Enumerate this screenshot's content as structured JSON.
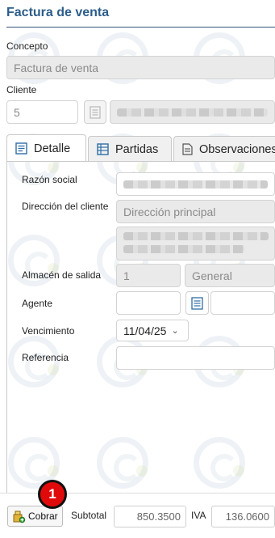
{
  "page": {
    "title": "Factura de venta"
  },
  "concepto": {
    "label": "Concepto",
    "value": "Factura de venta"
  },
  "cliente": {
    "label": "Cliente",
    "code": "5"
  },
  "tabs": [
    {
      "label": "Detalle",
      "icon": "document-lines-icon",
      "active": true
    },
    {
      "label": "Partidas",
      "icon": "table-grid-icon",
      "active": false
    },
    {
      "label": "Observaciones",
      "icon": "notes-page-icon",
      "active": false
    }
  ],
  "detalle": {
    "razon_social_label": "Razón social",
    "direccion_label": "Dirección del cliente",
    "direccion_value": "Dirección principal",
    "almacen_label": "Almacén de salida",
    "almacen_code": "1",
    "almacen_name": "General",
    "agente_label": "Agente",
    "vencimiento_label": "Vencimiento",
    "vencimiento_value": "11/04/25",
    "referencia_label": "Referencia"
  },
  "footer": {
    "cobrar_label": "Cobrar",
    "subtotal_label": "Subtotal",
    "subtotal_value": "850.3500",
    "iva_label": "IVA",
    "iva_value": "136.0600",
    "badge": "1"
  },
  "colors": {
    "title": "#2c5d8a",
    "badge": "#e10a0a",
    "tab_icon": "#2f6ea6"
  }
}
